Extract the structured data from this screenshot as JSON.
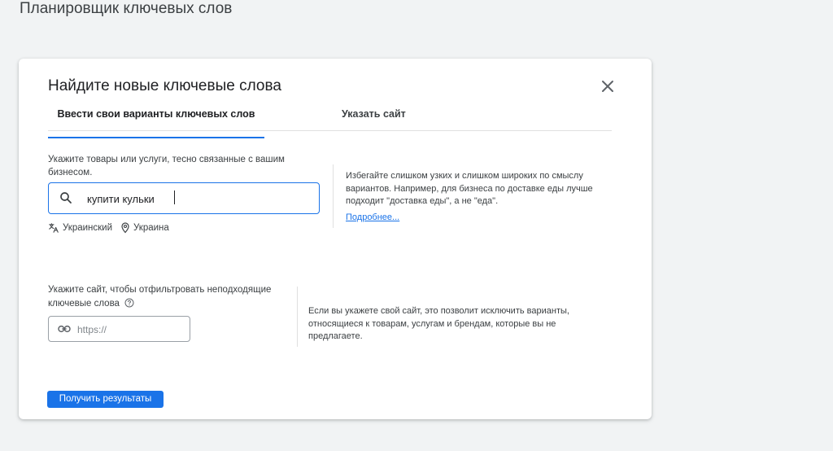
{
  "page": {
    "title": "Планировщик ключевых слов"
  },
  "modal": {
    "title": "Найдите новые ключевые слова",
    "close_icon": "close-icon"
  },
  "tabs": [
    {
      "label": "Ввести свои варианты ключевых слов",
      "active": true
    },
    {
      "label": "Указать сайт",
      "active": false
    }
  ],
  "keywords_section": {
    "prompt": "Укажите товары или услуги, тесно связанные с вашим бизнесом.",
    "input_value": "купити кульки",
    "language": "Украинский",
    "location": "Украина",
    "hint": "Избегайте слишком узких и слишком широких по смыслу вариантов. Например, для бизнеса по доставке еды лучше подходит \"доставка еды\", а не \"еда\".",
    "more_link": "Подробнее..."
  },
  "site_section": {
    "prompt": "Укажите сайт, чтобы отфильтровать неподходящие ключевые слова",
    "placeholder": "https://",
    "hint": "Если вы укажете свой сайт, это позволит исключить варианты, относящиеся к товарам, услугам и брендам, которые вы не предлагаете."
  },
  "actions": {
    "submit_label": "Получить результаты"
  },
  "colors": {
    "accent": "#1a73e8",
    "background": "#f1f3f4",
    "text": "#202124"
  }
}
